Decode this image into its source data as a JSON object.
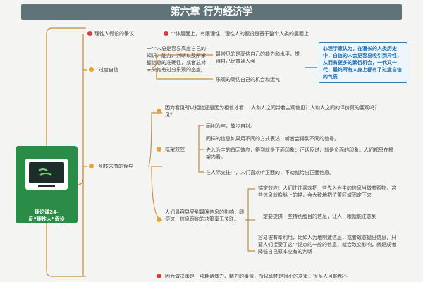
{
  "title": "第六章 行为经济学",
  "center": {
    "label": "理论课24-\n反“理性人”假设"
  },
  "branches": [
    {
      "label": "理性人假设的争议",
      "detail": "个体层面上，有限理性，理性人的假设是基于整个人类的层面上"
    },
    {
      "label": "过度自信",
      "sub1": "一个人总是容易高度自己的知识、能力、判断以及所掌握信息的准确性，或者总对未来抱有过分乐观的态度。",
      "sub2": [
        "最常见的是高估自己的能力和水平，觉得自己比普通人强",
        "乐观的高估自己的机会和运气"
      ],
      "highlight": "心理学家认为，在漫长的人类历史中，自信的人会更容易吸引到异性，从而有更多的繁衍机会，一代又一代，最终所有人身上都有了过度自信的气质"
    },
    {
      "label": "细枝末节的误导",
      "q": "因为看见所以相信还是因为相信才看见？",
      "q2": "人和人之间带着主观偏见？人和人之间的评价真的客观吗？",
      "frame_label": "框架效应",
      "frame_items": [
        "画地为牢，故步自封。",
        "同样的信息如果用不同的方式表述，听者会得到不同的信号。",
        "先入为主的首因效应，得到就是正面印象；正话反说，就是负面的印象。人们都只在框架内看。",
        "在人际交往中，人们喜欢听正面的，不劝就给出正面信息。"
      ],
      "anchor_label": "人们最容易受到最晚信息的影响，即便这一信息跟你的决策毫无关联。",
      "anchor_items": [
        "锚定效应：人们往往喜欢把一些先入为主的信息当做参照物，这些信息就像船上的锚，会大致地把位置区域固定下来",
        "一定要提供一些特别醒目的信息，让人一眼就能注意到",
        "容易被有奉利用，比如人为地制造信息，或者故意抛出信息，只要人们接受了这个锚点的一般的信息，就会改变影响，就是成者降低自己原本应有的判断"
      ]
    },
    {
      "label": "因为做决策是一项耗费体力、精力的事情，所以即使是很小的决策，很多人可能都不"
    }
  ]
}
